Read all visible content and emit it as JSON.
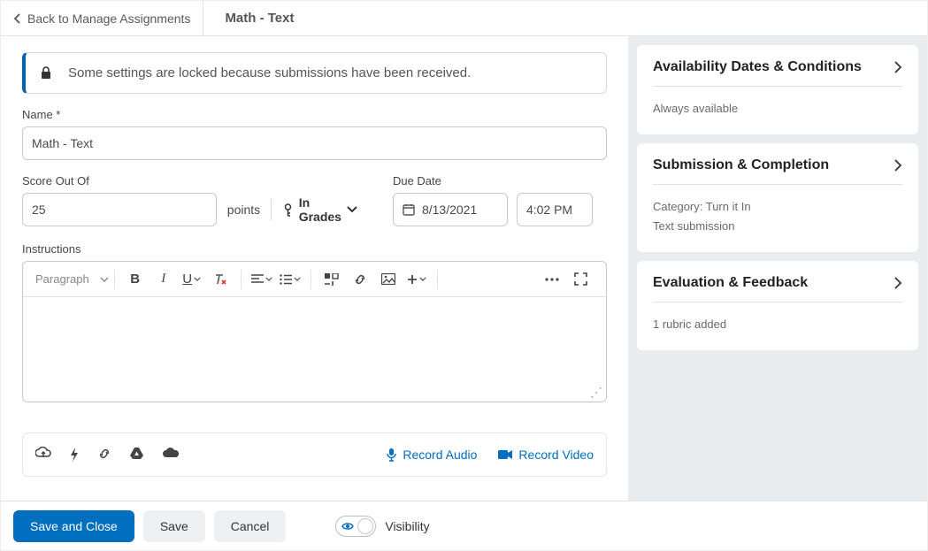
{
  "header": {
    "back_label": "Back to Manage Assignments",
    "title": "Math - Text"
  },
  "lock_banner": {
    "message": "Some settings are locked because submissions have been received."
  },
  "fields": {
    "name_label": "Name *",
    "name_value": "Math - Text",
    "score_label": "Score Out Of",
    "score_value": "25",
    "points_label": "points",
    "in_grades_label": "In Grades",
    "due_date_label": "Due Date",
    "due_date_value": "8/13/2021",
    "due_time_value": "4:02 PM",
    "instructions_label": "Instructions",
    "paragraph_label": "Paragraph"
  },
  "attach": {
    "record_audio": "Record Audio",
    "record_video": "Record Video"
  },
  "panels": {
    "availability": {
      "title": "Availability Dates & Conditions",
      "summary": "Always available"
    },
    "submission": {
      "title": "Submission & Completion",
      "line1": "Category: Turn it In",
      "line2": "Text submission"
    },
    "evaluation": {
      "title": "Evaluation & Feedback",
      "summary": "1 rubric added"
    }
  },
  "footer": {
    "save_close": "Save and Close",
    "save": "Save",
    "cancel": "Cancel",
    "visibility": "Visibility"
  }
}
